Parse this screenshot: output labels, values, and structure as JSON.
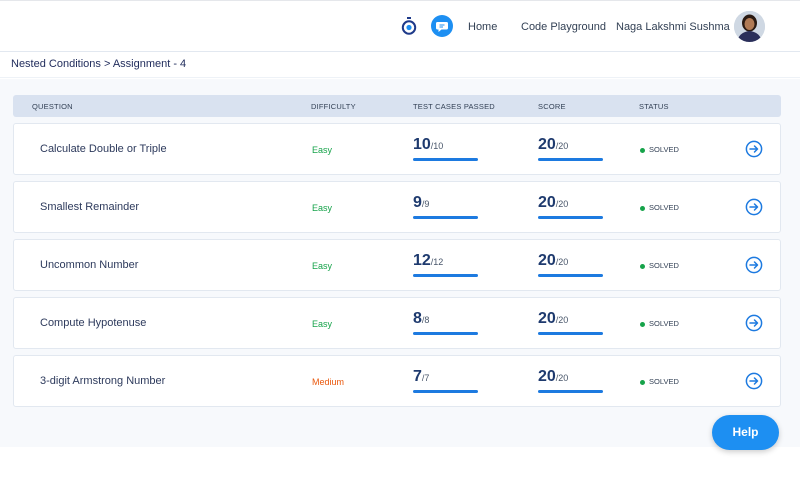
{
  "header": {
    "home_label": "Home",
    "code_playground_label": "Code Playground",
    "user_name": "Naga Lakshmi Sushma"
  },
  "breadcrumb": "Nested Conditions > Assignment - 4",
  "table": {
    "columns": {
      "question": "QUESTION",
      "difficulty": "DIFFICULTY",
      "tests": "TEST CASES PASSED",
      "score": "SCORE",
      "status": "STATUS"
    },
    "rows": [
      {
        "question": "Calculate Double or Triple",
        "difficulty": "Easy",
        "level": "easy",
        "passed": "10",
        "total": "/10",
        "score": "20",
        "score_total": "/20",
        "status": "SOLVED"
      },
      {
        "question": "Smallest Remainder",
        "difficulty": "Easy",
        "level": "easy",
        "passed": "9",
        "total": "/9",
        "score": "20",
        "score_total": "/20",
        "status": "SOLVED"
      },
      {
        "question": "Uncommon Number",
        "difficulty": "Easy",
        "level": "easy",
        "passed": "12",
        "total": "/12",
        "score": "20",
        "score_total": "/20",
        "status": "SOLVED"
      },
      {
        "question": "Compute Hypotenuse",
        "difficulty": "Easy",
        "level": "easy",
        "passed": "8",
        "total": "/8",
        "score": "20",
        "score_total": "/20",
        "status": "SOLVED"
      },
      {
        "question": "3-digit Armstrong Number",
        "difficulty": "Medium",
        "level": "medium",
        "passed": "7",
        "total": "/7",
        "score": "20",
        "score_total": "/20",
        "status": "SOLVED"
      }
    ]
  },
  "help_label": "Help",
  "colors": {
    "accent": "#1d8ff2",
    "easy": "#16a34a",
    "medium": "#ea580c",
    "progress": "#1d7ae0"
  },
  "icons": {
    "timer": "stopwatch-icon",
    "chat": "chat-bubble-icon",
    "row_action": "arrow-right-circle-icon"
  }
}
